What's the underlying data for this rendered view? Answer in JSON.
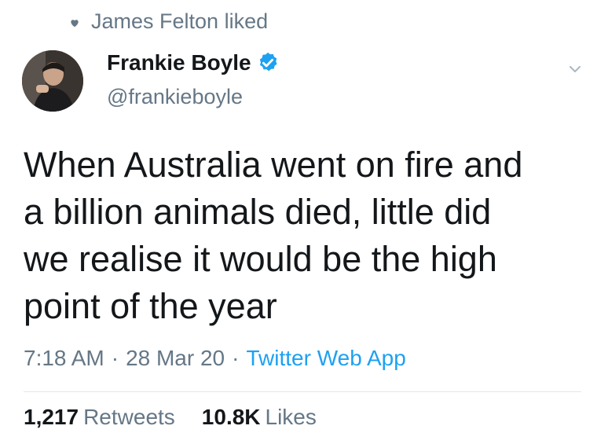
{
  "social_context": {
    "icon": "heart-icon",
    "text": "James Felton liked"
  },
  "author": {
    "name": "Frankie Boyle",
    "handle": "@frankieboyle",
    "verified_icon": "verified-badge-icon"
  },
  "tweet": {
    "text": "When Australia went on fire and\na billion animals died, little did\nwe realise it would be the high\npoint of the year"
  },
  "meta": {
    "time": "7:18 AM",
    "separator": "·",
    "date": "28 Mar 20",
    "source": "Twitter Web App"
  },
  "stats": {
    "retweets_count": "1,217",
    "retweets_label": "Retweets",
    "likes_count": "10.8K",
    "likes_label": "Likes"
  },
  "colors": {
    "text": "#14171a",
    "muted": "#657786",
    "link": "#1da1f2",
    "divider": "#e1e8ed"
  }
}
